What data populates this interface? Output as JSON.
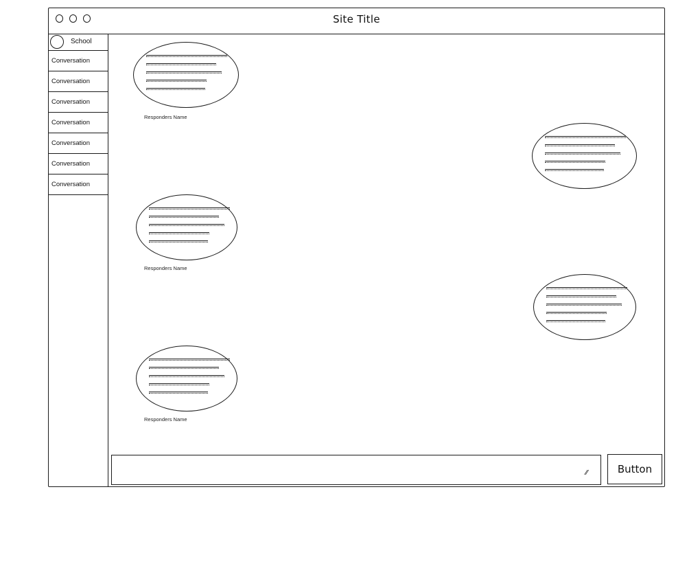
{
  "window": {
    "title": "Site Title",
    "controls": [
      "close-icon",
      "minimize-icon",
      "maximize-icon"
    ]
  },
  "sidebar": {
    "header": {
      "avatar_icon": "avatar-circle-icon",
      "label": "School"
    },
    "items": [
      {
        "label": "Conversation"
      },
      {
        "label": "Conversation"
      },
      {
        "label": "Conversation"
      },
      {
        "label": "Conversation"
      },
      {
        "label": "Conversation"
      },
      {
        "label": "Conversation"
      },
      {
        "label": "Conversation"
      }
    ]
  },
  "messages": [
    {
      "side": "left",
      "responder": "Responders Name"
    },
    {
      "side": "right",
      "responder": ""
    },
    {
      "side": "left",
      "responder": "Responders Name"
    },
    {
      "side": "right",
      "responder": ""
    },
    {
      "side": "left",
      "responder": "Responders Name"
    }
  ],
  "composer": {
    "input_value": "",
    "resize_icon": "resize-grip-icon",
    "button_label": "Button"
  }
}
